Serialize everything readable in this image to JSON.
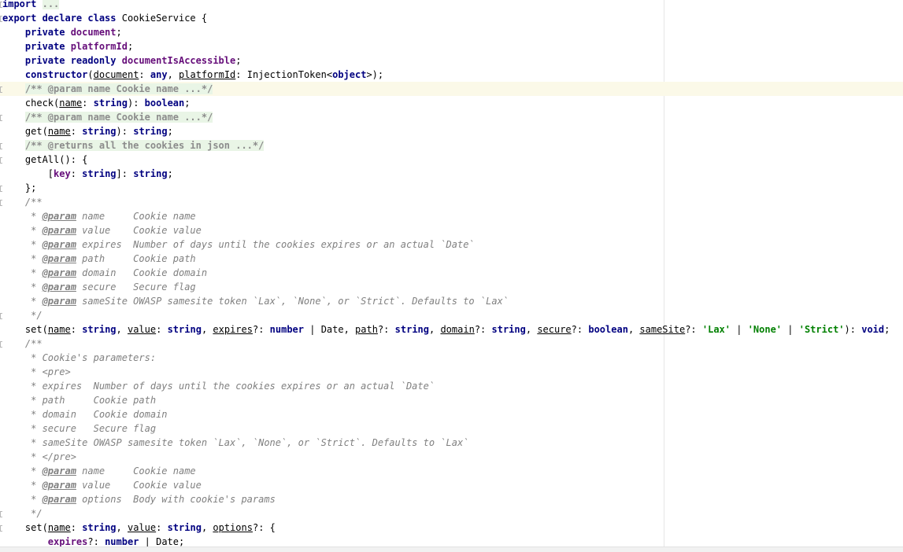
{
  "editor": {
    "lines": [
      {
        "fold": true,
        "highlight": false,
        "tokens": [
          {
            "t": "import",
            "c": "kw"
          },
          {
            "t": " ",
            "c": "pl"
          },
          {
            "t": "...",
            "c": "fc"
          }
        ]
      },
      {
        "fold": true,
        "highlight": false,
        "tokens": [
          {
            "t": "export declare class ",
            "c": "kw"
          },
          {
            "t": "CookieService {",
            "c": "pl"
          }
        ]
      },
      {
        "fold": false,
        "highlight": false,
        "tokens": [
          {
            "t": "    ",
            "c": "pl"
          },
          {
            "t": "private ",
            "c": "kw"
          },
          {
            "t": "document",
            "c": "fld"
          },
          {
            "t": ";",
            "c": "pl"
          }
        ]
      },
      {
        "fold": false,
        "highlight": false,
        "tokens": [
          {
            "t": "    ",
            "c": "pl"
          },
          {
            "t": "private ",
            "c": "kw"
          },
          {
            "t": "platformId",
            "c": "fld"
          },
          {
            "t": ";",
            "c": "pl"
          }
        ]
      },
      {
        "fold": false,
        "highlight": false,
        "tokens": [
          {
            "t": "    ",
            "c": "pl"
          },
          {
            "t": "private readonly ",
            "c": "kw"
          },
          {
            "t": "documentIsAccessible",
            "c": "fld"
          },
          {
            "t": ";",
            "c": "pl"
          }
        ]
      },
      {
        "fold": false,
        "highlight": false,
        "tokens": [
          {
            "t": "    ",
            "c": "pl"
          },
          {
            "t": "constructor",
            "c": "kw"
          },
          {
            "t": "(",
            "c": "pl"
          },
          {
            "t": "document",
            "c": "par"
          },
          {
            "t": ": ",
            "c": "pl"
          },
          {
            "t": "any",
            "c": "kw"
          },
          {
            "t": ", ",
            "c": "pl"
          },
          {
            "t": "platformId",
            "c": "par"
          },
          {
            "t": ": InjectionToken<",
            "c": "pl"
          },
          {
            "t": "object",
            "c": "kw"
          },
          {
            "t": ">);",
            "c": "pl"
          }
        ]
      },
      {
        "fold": true,
        "highlight": true,
        "tokens": [
          {
            "t": "    ",
            "c": "pl"
          },
          {
            "t": "/** @param name Cookie name ...*/",
            "c": "fc"
          }
        ]
      },
      {
        "fold": false,
        "highlight": false,
        "tokens": [
          {
            "t": "    ",
            "c": "pl"
          },
          {
            "t": "check",
            "c": "fn"
          },
          {
            "t": "(",
            "c": "pl"
          },
          {
            "t": "name",
            "c": "par"
          },
          {
            "t": ": ",
            "c": "pl"
          },
          {
            "t": "string",
            "c": "kw"
          },
          {
            "t": "): ",
            "c": "pl"
          },
          {
            "t": "boolean",
            "c": "kw"
          },
          {
            "t": ";",
            "c": "pl"
          }
        ]
      },
      {
        "fold": true,
        "highlight": false,
        "tokens": [
          {
            "t": "    ",
            "c": "pl"
          },
          {
            "t": "/** @param name Cookie name ...*/",
            "c": "fc"
          }
        ]
      },
      {
        "fold": false,
        "highlight": false,
        "tokens": [
          {
            "t": "    ",
            "c": "pl"
          },
          {
            "t": "get",
            "c": "fn"
          },
          {
            "t": "(",
            "c": "pl"
          },
          {
            "t": "name",
            "c": "par"
          },
          {
            "t": ": ",
            "c": "pl"
          },
          {
            "t": "string",
            "c": "kw"
          },
          {
            "t": "): ",
            "c": "pl"
          },
          {
            "t": "string",
            "c": "kw"
          },
          {
            "t": ";",
            "c": "pl"
          }
        ]
      },
      {
        "fold": true,
        "highlight": false,
        "tokens": [
          {
            "t": "    ",
            "c": "pl"
          },
          {
            "t": "/** @returns all the cookies in json ...*/",
            "c": "fc"
          }
        ]
      },
      {
        "fold": true,
        "highlight": false,
        "tokens": [
          {
            "t": "    ",
            "c": "pl"
          },
          {
            "t": "getAll",
            "c": "fn"
          },
          {
            "t": "(): {",
            "c": "pl"
          }
        ]
      },
      {
        "fold": false,
        "highlight": false,
        "tokens": [
          {
            "t": "        [",
            "c": "pl"
          },
          {
            "t": "key",
            "c": "fld"
          },
          {
            "t": ": ",
            "c": "pl"
          },
          {
            "t": "string",
            "c": "kw"
          },
          {
            "t": "]: ",
            "c": "pl"
          },
          {
            "t": "string",
            "c": "kw"
          },
          {
            "t": ";",
            "c": "pl"
          }
        ]
      },
      {
        "fold": true,
        "highlight": false,
        "tokens": [
          {
            "t": "    };",
            "c": "pl"
          }
        ]
      },
      {
        "fold": true,
        "highlight": false,
        "tokens": [
          {
            "t": "    /**",
            "c": "cm"
          }
        ]
      },
      {
        "fold": false,
        "highlight": false,
        "tokens": [
          {
            "t": "     * ",
            "c": "cm"
          },
          {
            "t": "@param",
            "c": "tg"
          },
          {
            "t": " name     Cookie name",
            "c": "cm"
          }
        ]
      },
      {
        "fold": false,
        "highlight": false,
        "tokens": [
          {
            "t": "     * ",
            "c": "cm"
          },
          {
            "t": "@param",
            "c": "tg"
          },
          {
            "t": " value    Cookie value",
            "c": "cm"
          }
        ]
      },
      {
        "fold": false,
        "highlight": false,
        "tokens": [
          {
            "t": "     * ",
            "c": "cm"
          },
          {
            "t": "@param",
            "c": "tg"
          },
          {
            "t": " expires  Number of days until the cookies expires or an actual `Date`",
            "c": "cm"
          }
        ]
      },
      {
        "fold": false,
        "highlight": false,
        "tokens": [
          {
            "t": "     * ",
            "c": "cm"
          },
          {
            "t": "@param",
            "c": "tg"
          },
          {
            "t": " path     Cookie path",
            "c": "cm"
          }
        ]
      },
      {
        "fold": false,
        "highlight": false,
        "tokens": [
          {
            "t": "     * ",
            "c": "cm"
          },
          {
            "t": "@param",
            "c": "tg"
          },
          {
            "t": " domain   Cookie domain",
            "c": "cm"
          }
        ]
      },
      {
        "fold": false,
        "highlight": false,
        "tokens": [
          {
            "t": "     * ",
            "c": "cm"
          },
          {
            "t": "@param",
            "c": "tg"
          },
          {
            "t": " secure   Secure flag",
            "c": "cm"
          }
        ]
      },
      {
        "fold": false,
        "highlight": false,
        "tokens": [
          {
            "t": "     * ",
            "c": "cm"
          },
          {
            "t": "@param",
            "c": "tg"
          },
          {
            "t": " sameSite OWASP samesite token `Lax`, `None`, or `Strict`. Defaults to `Lax`",
            "c": "cm"
          }
        ]
      },
      {
        "fold": true,
        "highlight": false,
        "tokens": [
          {
            "t": "     */",
            "c": "cm"
          }
        ]
      },
      {
        "fold": false,
        "highlight": false,
        "tokens": [
          {
            "t": "    ",
            "c": "pl"
          },
          {
            "t": "set",
            "c": "fn"
          },
          {
            "t": "(",
            "c": "pl"
          },
          {
            "t": "name",
            "c": "par"
          },
          {
            "t": ": ",
            "c": "pl"
          },
          {
            "t": "string",
            "c": "kw"
          },
          {
            "t": ", ",
            "c": "pl"
          },
          {
            "t": "value",
            "c": "par"
          },
          {
            "t": ": ",
            "c": "pl"
          },
          {
            "t": "string",
            "c": "kw"
          },
          {
            "t": ", ",
            "c": "pl"
          },
          {
            "t": "expires",
            "c": "par"
          },
          {
            "t": "?: ",
            "c": "pl"
          },
          {
            "t": "number",
            "c": "kw"
          },
          {
            "t": " | Date, ",
            "c": "pl"
          },
          {
            "t": "path",
            "c": "par"
          },
          {
            "t": "?: ",
            "c": "pl"
          },
          {
            "t": "string",
            "c": "kw"
          },
          {
            "t": ", ",
            "c": "pl"
          },
          {
            "t": "domain",
            "c": "par"
          },
          {
            "t": "?: ",
            "c": "pl"
          },
          {
            "t": "string",
            "c": "kw"
          },
          {
            "t": ", ",
            "c": "pl"
          },
          {
            "t": "secure",
            "c": "par"
          },
          {
            "t": "?: ",
            "c": "pl"
          },
          {
            "t": "boolean",
            "c": "kw"
          },
          {
            "t": ", ",
            "c": "pl"
          },
          {
            "t": "sameSite",
            "c": "par"
          },
          {
            "t": "?: ",
            "c": "pl"
          },
          {
            "t": "'Lax'",
            "c": "str"
          },
          {
            "t": " | ",
            "c": "pl"
          },
          {
            "t": "'None'",
            "c": "str"
          },
          {
            "t": " | ",
            "c": "pl"
          },
          {
            "t": "'Strict'",
            "c": "str"
          },
          {
            "t": "): ",
            "c": "pl"
          },
          {
            "t": "void",
            "c": "kw"
          },
          {
            "t": ";",
            "c": "pl"
          }
        ]
      },
      {
        "fold": true,
        "highlight": false,
        "tokens": [
          {
            "t": "    /**",
            "c": "cm"
          }
        ]
      },
      {
        "fold": false,
        "highlight": false,
        "tokens": [
          {
            "t": "     * Cookie's parameters:",
            "c": "cm"
          }
        ]
      },
      {
        "fold": false,
        "highlight": false,
        "tokens": [
          {
            "t": "     * <pre>",
            "c": "cm"
          }
        ]
      },
      {
        "fold": false,
        "highlight": false,
        "tokens": [
          {
            "t": "     * expires  Number of days until the cookies expires or an actual `Date`",
            "c": "cm"
          }
        ]
      },
      {
        "fold": false,
        "highlight": false,
        "tokens": [
          {
            "t": "     * path     Cookie path",
            "c": "cm"
          }
        ]
      },
      {
        "fold": false,
        "highlight": false,
        "tokens": [
          {
            "t": "     * domain   Cookie domain",
            "c": "cm"
          }
        ]
      },
      {
        "fold": false,
        "highlight": false,
        "tokens": [
          {
            "t": "     * secure   Secure flag",
            "c": "cm"
          }
        ]
      },
      {
        "fold": false,
        "highlight": false,
        "tokens": [
          {
            "t": "     * sameSite OWASP samesite token `Lax`, `None`, or `Strict`. Defaults to `Lax`",
            "c": "cm"
          }
        ]
      },
      {
        "fold": false,
        "highlight": false,
        "tokens": [
          {
            "t": "     * </pre>",
            "c": "cm"
          }
        ]
      },
      {
        "fold": false,
        "highlight": false,
        "tokens": [
          {
            "t": "     * ",
            "c": "cm"
          },
          {
            "t": "@param",
            "c": "tg"
          },
          {
            "t": " name     Cookie name",
            "c": "cm"
          }
        ]
      },
      {
        "fold": false,
        "highlight": false,
        "tokens": [
          {
            "t": "     * ",
            "c": "cm"
          },
          {
            "t": "@param",
            "c": "tg"
          },
          {
            "t": " value    Cookie value",
            "c": "cm"
          }
        ]
      },
      {
        "fold": false,
        "highlight": false,
        "tokens": [
          {
            "t": "     * ",
            "c": "cm"
          },
          {
            "t": "@param",
            "c": "tg"
          },
          {
            "t": " options  Body with cookie's params",
            "c": "cm"
          }
        ]
      },
      {
        "fold": true,
        "highlight": false,
        "tokens": [
          {
            "t": "     */",
            "c": "cm"
          }
        ]
      },
      {
        "fold": true,
        "highlight": false,
        "tokens": [
          {
            "t": "    ",
            "c": "pl"
          },
          {
            "t": "set",
            "c": "fn"
          },
          {
            "t": "(",
            "c": "pl"
          },
          {
            "t": "name",
            "c": "par"
          },
          {
            "t": ": ",
            "c": "pl"
          },
          {
            "t": "string",
            "c": "kw"
          },
          {
            "t": ", ",
            "c": "pl"
          },
          {
            "t": "value",
            "c": "par"
          },
          {
            "t": ": ",
            "c": "pl"
          },
          {
            "t": "string",
            "c": "kw"
          },
          {
            "t": ", ",
            "c": "pl"
          },
          {
            "t": "options",
            "c": "par"
          },
          {
            "t": "?: {",
            "c": "pl"
          }
        ]
      },
      {
        "fold": false,
        "highlight": false,
        "tokens": [
          {
            "t": "        ",
            "c": "pl"
          },
          {
            "t": "expires",
            "c": "fld"
          },
          {
            "t": "?: ",
            "c": "pl"
          },
          {
            "t": "number",
            "c": "kw"
          },
          {
            "t": " | Date;",
            "c": "pl"
          }
        ]
      }
    ]
  }
}
